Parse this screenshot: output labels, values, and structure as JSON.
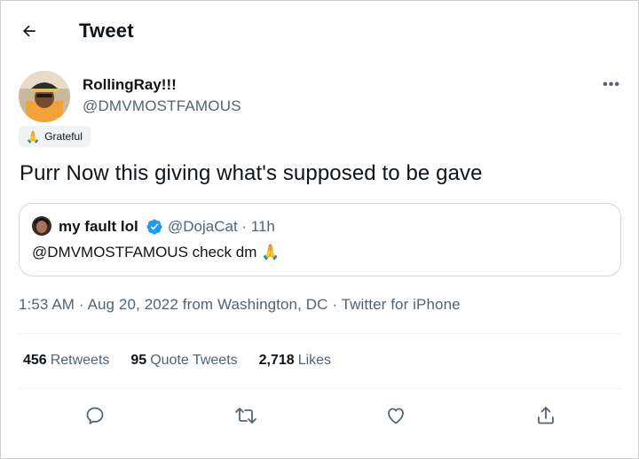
{
  "header": {
    "title": "Tweet",
    "back_icon": "arrow-left-icon"
  },
  "author": {
    "display_name": "RollingRay!!!",
    "handle": "@DMVMOSTFAMOUS",
    "more_label": "•••",
    "label_chip": {
      "emoji": "🙏",
      "text": "Grateful"
    }
  },
  "tweet": {
    "text": "Purr Now this giving what's supposed to be gave"
  },
  "quoted_tweet": {
    "display_name": "my fault lol",
    "verified_icon": "verified-badge-icon",
    "handle_time": "@DojaCat · 11h",
    "text": "@DMVMOSTFAMOUS check dm 🙏"
  },
  "meta": {
    "time": "1:53 AM",
    "sep1": " · ",
    "date": "Aug 20, 2022",
    "location": " from Washington, DC",
    "sep2": " · ",
    "source": "Twitter for iPhone"
  },
  "stats": {
    "retweets_count": "456",
    "retweets_label": "Retweets",
    "quotes_count": "95",
    "quotes_label": "Quote Tweets",
    "likes_count": "2,718",
    "likes_label": "Likes"
  },
  "actions": {
    "reply_icon": "reply-icon",
    "retweet_icon": "retweet-icon",
    "like_icon": "heart-icon",
    "share_icon": "share-icon"
  },
  "colors": {
    "text": "#0f1419",
    "secondary": "#536471",
    "verified": "#1d9bf0",
    "border": "#cfd9de"
  }
}
